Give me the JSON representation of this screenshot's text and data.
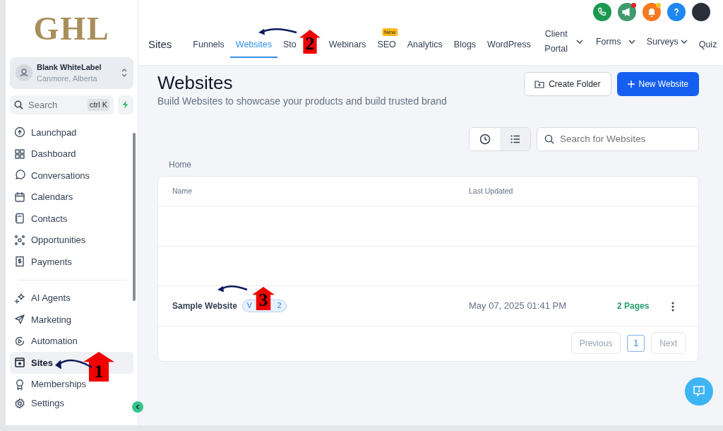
{
  "logo": {
    "text": "GHL"
  },
  "account": {
    "name": "Blank WhiteLabel",
    "location": "Canmore, Alberta"
  },
  "search": {
    "placeholder": "Search",
    "shortcut": "ctrl K"
  },
  "sidebar": {
    "groups": [
      [
        {
          "label": "Launchpad",
          "selected": false
        },
        {
          "label": "Dashboard",
          "selected": false
        },
        {
          "label": "Conversations",
          "selected": false
        },
        {
          "label": "Calendars",
          "selected": false
        },
        {
          "label": "Contacts",
          "selected": false
        },
        {
          "label": "Opportunities",
          "selected": false
        },
        {
          "label": "Payments",
          "selected": false
        }
      ],
      [
        {
          "label": "AI Agents",
          "selected": false
        },
        {
          "label": "Marketing",
          "selected": false
        },
        {
          "label": "Automation",
          "selected": false
        },
        {
          "label": "Sites",
          "selected": true
        },
        {
          "label": "Memberships",
          "selected": false
        }
      ]
    ],
    "footer": {
      "label": "Settings",
      "selected": false
    }
  },
  "top_icons": [
    {
      "kind": "phone",
      "color": "#1a9850"
    },
    {
      "kind": "megaphone",
      "color": "#3f9a6e",
      "dot": {
        "color": "#e8202a"
      }
    },
    {
      "kind": "bell",
      "color": "#f5791f",
      "dot": {
        "color": "#f6c431"
      }
    },
    {
      "kind": "help",
      "color": "#1e88f0"
    },
    {
      "kind": "avatar",
      "color": "#2a2f3a"
    }
  ],
  "header": {
    "title": "Sites",
    "tabs": [
      {
        "label": "Funnels",
        "selected": false,
        "dropdown": false
      },
      {
        "label": "Websites",
        "selected": true,
        "dropdown": false
      },
      {
        "label": "Sto",
        "selected": false,
        "dropdown": false
      },
      {
        "label": "Webinars",
        "selected": false,
        "dropdown": false
      },
      {
        "label": "SEO",
        "selected": false,
        "dropdown": false,
        "badge": "New"
      },
      {
        "label": "Analytics",
        "selected": false,
        "dropdown": false
      },
      {
        "label": "Blogs",
        "selected": false,
        "dropdown": false
      },
      {
        "label": "WordPress",
        "selected": false,
        "dropdown": false
      },
      {
        "label": "Client Portal",
        "selected": false,
        "dropdown": true
      },
      {
        "label": "Forms",
        "selected": false,
        "dropdown": true
      },
      {
        "label": "Surveys",
        "selected": false,
        "dropdown": true
      },
      {
        "label": "Quiz",
        "selected": false,
        "dropdown": false
      }
    ]
  },
  "page": {
    "title": "Websites",
    "subtitle": "Build Websites to showcase your products and build trusted brand",
    "buttons": [
      {
        "label": "Create Folder",
        "kind": "secondary"
      },
      {
        "label": "New Website",
        "kind": "primary"
      }
    ],
    "views": [
      {
        "kind": "recent",
        "selected": false
      },
      {
        "kind": "list",
        "selected": true
      }
    ],
    "search": {
      "placeholder": "Search for Websites"
    },
    "breadcrumb": "Home",
    "table": {
      "columns": [
        "Name",
        "Last Updated"
      ],
      "rows": [
        {
          "name": "Sample Website",
          "version": [
            "V",
            "2"
          ],
          "updated": "May 07, 2025 01:41 PM",
          "pages": "2 Pages"
        }
      ]
    },
    "pagination": {
      "previous": "Previous",
      "pages": [
        {
          "label": "1",
          "selected": true
        }
      ],
      "next": "Next"
    }
  },
  "annotations": [
    {
      "number": "1"
    },
    {
      "number": "2"
    },
    {
      "number": "3"
    }
  ]
}
